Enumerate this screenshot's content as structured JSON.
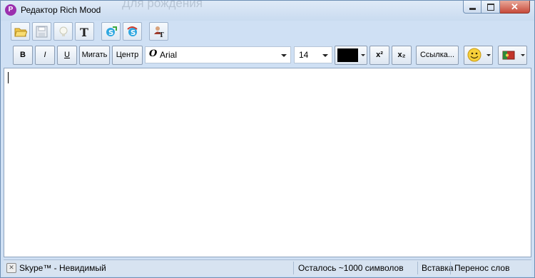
{
  "window": {
    "title": "Редактор Rich Mood",
    "background_title": "Для рождения",
    "controls": {
      "minimize": "minimize",
      "maximize": "maximize",
      "close": "✕"
    }
  },
  "toolbar1": {
    "buttons": [
      {
        "name": "open-folder-icon"
      },
      {
        "name": "save-icon"
      },
      {
        "name": "lightbulb-icon"
      },
      {
        "name": "text-format-icon",
        "glyph": "T"
      },
      {
        "name": "skype-insert-icon"
      },
      {
        "name": "skype-mood-icon"
      },
      {
        "name": "user-text-icon"
      }
    ]
  },
  "toolbar2": {
    "bold": "B",
    "italic": "I",
    "underline": "U",
    "blink": "Мигать",
    "center": "Центр",
    "font_name": "Arial",
    "font_size": "14",
    "text_color": "#000000",
    "superscript": "x²",
    "subscript": "x₂",
    "link": "Ссылка...",
    "emoticon": "smiley",
    "flag": "flag"
  },
  "status": {
    "skype_status": "Skype™ - Невидимый",
    "chars_left": "Осталось ~1000 символов",
    "insert_mode": "Вставка",
    "word_wrap": "Перенос слов"
  }
}
